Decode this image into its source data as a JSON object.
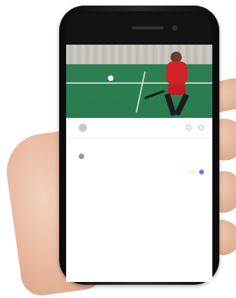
{
  "chat": {
    "header_title": "",
    "header_subtitle": "",
    "date_label": "",
    "incoming_message": "",
    "outgoing_message": ""
  },
  "colors": {
    "court": "#2a7c4f",
    "jersey": "#d3222a",
    "outgoing_bubble": "#fff3c7"
  }
}
